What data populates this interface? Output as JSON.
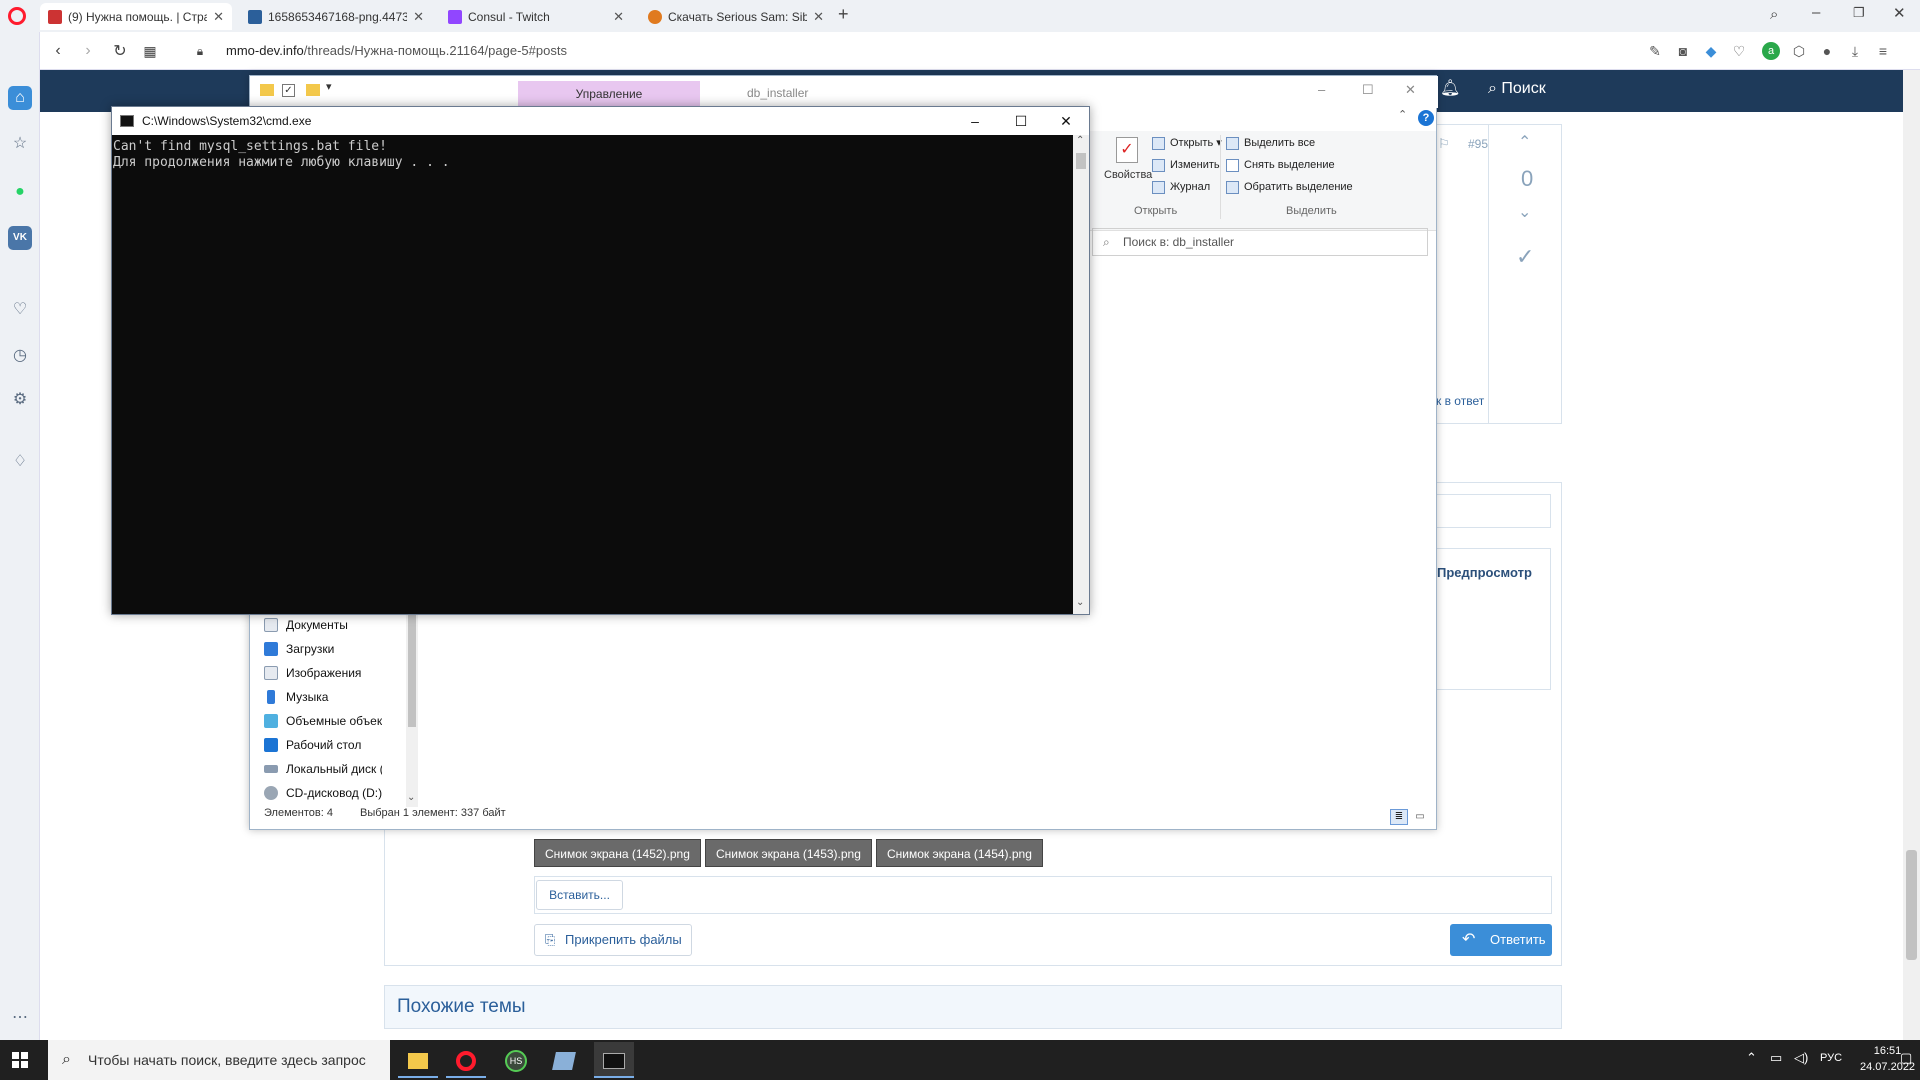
{
  "browser": {
    "tabs": [
      {
        "label": "(9) Нужна помощь. | Стра",
        "active": true
      },
      {
        "label": "1658653467168-png.4473",
        "active": false
      },
      {
        "label": "Consul - Twitch",
        "active": false
      },
      {
        "label": "Скачать Serious Sam: Sibe",
        "active": false
      }
    ],
    "new_tab": "+",
    "url_host": "mmo-dev.info",
    "url_path": "/threads/Нужна-помощь.21164/page-5#posts",
    "colors": {
      "accent": "#ff1b2d",
      "header": "#1e3a5a",
      "link": "#2b5f9a",
      "reply": "#3b8ed8"
    }
  },
  "forum": {
    "search_label": "Поиск",
    "post_number": "#95",
    "vote_count": "0",
    "reply_link": "к в ответ",
    "preview_label": "Предпросмотр",
    "attachments": [
      "Снимок экрана (1452).png",
      "Снимок экрана (1453).png",
      "Снимок экрана (1454).png"
    ],
    "paste_label": "Вставить...",
    "attach_files_label": "Прикрепить файлы",
    "reply_label": "Ответить",
    "similar_topics": "Похожие темы"
  },
  "explorer": {
    "ribbon_tab_manage": "Управление",
    "folder_title": "db_installer",
    "ribbon": {
      "properties": "Свойства",
      "open": "Открыть",
      "edit": "Изменить",
      "history": "Журнал",
      "open_group": "Открыть",
      "select_all": "Выделить все",
      "select_none": "Снять выделение",
      "invert_selection": "Обратить выделение",
      "select_group": "Выделить"
    },
    "search_placeholder": "Поиск в: db_installer",
    "tree": [
      "Документы",
      "Загрузки",
      "Изображения",
      "Музыка",
      "Объемные объект",
      "Рабочий стол",
      "Локальный диск (C",
      "CD-дисковод (D:)"
    ],
    "status_count": "Элементов: 4",
    "status_selected": "Выбран 1 элемент: 337 байт"
  },
  "cmd": {
    "title": "C:\\Windows\\System32\\cmd.exe",
    "output": "Can't find mysql_settings.bat file!\nДля продолжения нажмите любую клавишу . . ."
  },
  "taskbar": {
    "search_placeholder": "Чтобы начать поиск, введите здесь запрос",
    "language": "РУС",
    "time": "16:51",
    "date": "24.07.2022"
  }
}
